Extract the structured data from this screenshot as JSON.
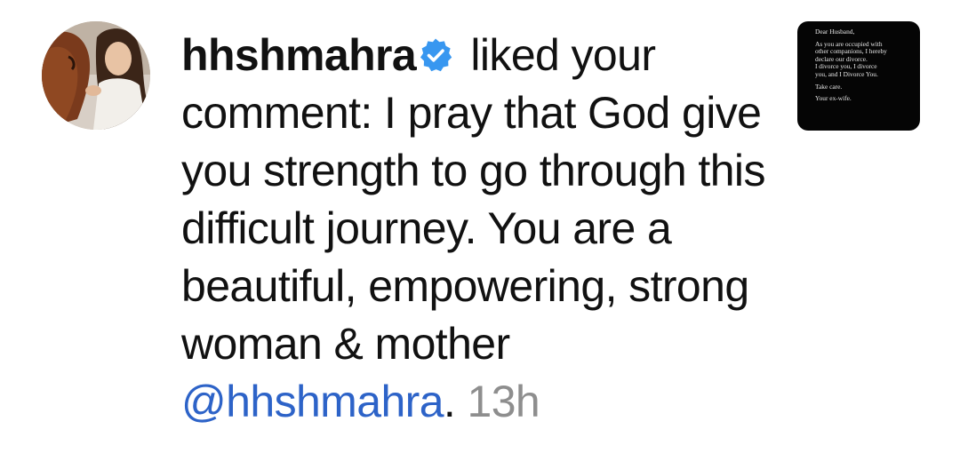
{
  "notification": {
    "avatar_icon": "profile-photo-woman-with-horse",
    "username": "hhshmahra",
    "verified_icon": "verified-badge-icon",
    "verified_color": "#3897f0",
    "action_text": " liked your comment: I pray that God give you strength to go through this difficult journey. You are a beautiful, empowering, strong woman & mother ",
    "mention": "@hhshmahra",
    "trailing_punct": ". ",
    "timestamp": "13h",
    "mention_color": "#2d63c8",
    "timestamp_color": "#8e8e8e"
  },
  "post_thumbnail": {
    "line1": "Dear Husband,",
    "line2": "As you are occupied with\nother companions, I hereby\ndeclare our divorce.\nI divorce you, I divorce\nyou, and I Divorce You.",
    "line3": "Take care.",
    "line4": "Your ex-wife."
  }
}
